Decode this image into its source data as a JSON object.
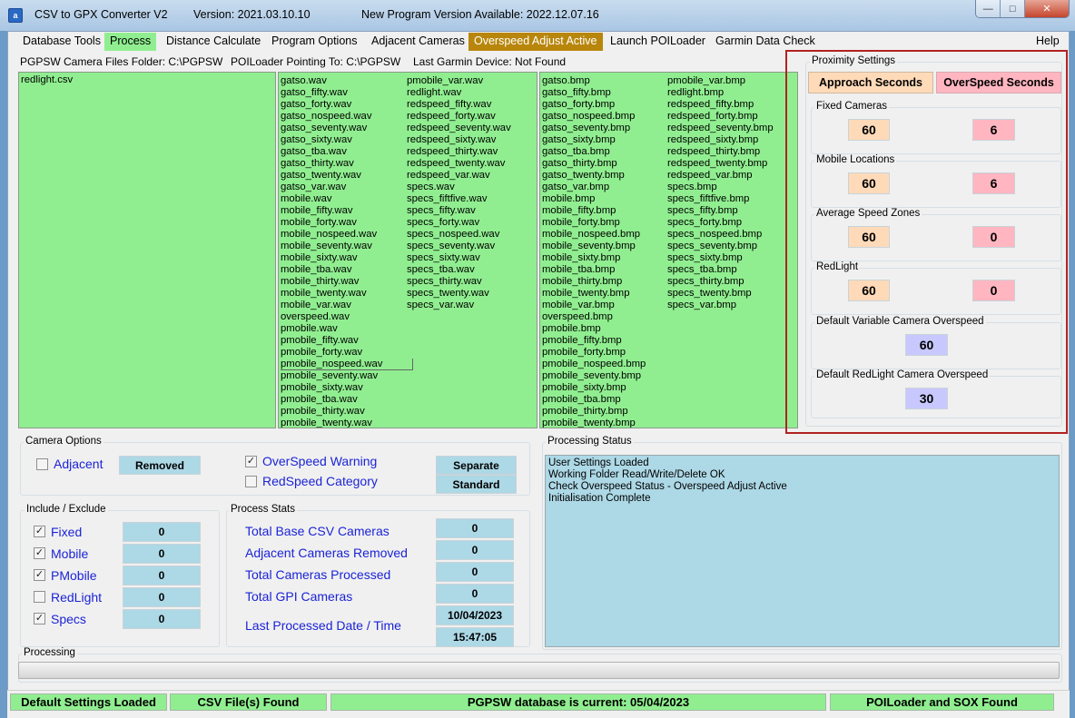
{
  "window": {
    "app_name": "CSV to GPX Converter V2",
    "version": "Version: 2021.03.10.10",
    "update_notice": "New Program Version Available: 2022.12.07.16",
    "icon_text": "a"
  },
  "menu": [
    "Database Tools",
    "Process",
    "Distance Calculate",
    "Program Options",
    "Adjacent Cameras",
    "Overspeed Adjust Active",
    "Launch POILoader",
    "Garmin Data Check",
    "Help"
  ],
  "info": {
    "folder": "PGPSW Camera Files Folder:  C:\\PGPSW",
    "poiloader": "POILoader Pointing To:  C:\\PGPSW",
    "last_device": "Last Garmin Device:  Not Found"
  },
  "csv_files": [
    "redlight.csv"
  ],
  "wav_files_col1": [
    "gatso.wav",
    "gatso_fifty.wav",
    "gatso_forty.wav",
    "gatso_nospeed.wav",
    "gatso_seventy.wav",
    "gatso_sixty.wav",
    "gatso_tba.wav",
    "gatso_thirty.wav",
    "gatso_twenty.wav",
    "gatso_var.wav",
    "mobile.wav",
    "mobile_fifty.wav",
    "mobile_forty.wav",
    "mobile_nospeed.wav",
    "mobile_seventy.wav",
    "mobile_sixty.wav",
    "mobile_tba.wav",
    "mobile_thirty.wav",
    "mobile_twenty.wav",
    "mobile_var.wav",
    "overspeed.wav",
    "pmobile.wav",
    "pmobile_fifty.wav",
    "pmobile_forty.wav",
    "pmobile_nospeed.wav",
    "pmobile_seventy.wav",
    "pmobile_sixty.wav",
    "pmobile_tba.wav",
    "pmobile_thirty.wav",
    "pmobile_twenty.wav"
  ],
  "wav_files_col2": [
    "pmobile_var.wav",
    "redlight.wav",
    "redspeed_fifty.wav",
    "redspeed_forty.wav",
    "redspeed_seventy.wav",
    "redspeed_sixty.wav",
    "redspeed_thirty.wav",
    "redspeed_twenty.wav",
    "redspeed_var.wav",
    "specs.wav",
    "specs_fiftfive.wav",
    "specs_fifty.wav",
    "specs_forty.wav",
    "specs_nospeed.wav",
    "specs_seventy.wav",
    "specs_sixty.wav",
    "specs_tba.wav",
    "specs_thirty.wav",
    "specs_twenty.wav",
    "specs_var.wav"
  ],
  "bmp_files_col1": [
    "gatso.bmp",
    "gatso_fifty.bmp",
    "gatso_forty.bmp",
    "gatso_nospeed.bmp",
    "gatso_seventy.bmp",
    "gatso_sixty.bmp",
    "gatso_tba.bmp",
    "gatso_thirty.bmp",
    "gatso_twenty.bmp",
    "gatso_var.bmp",
    "mobile.bmp",
    "mobile_fifty.bmp",
    "mobile_forty.bmp",
    "mobile_nospeed.bmp",
    "mobile_seventy.bmp",
    "mobile_sixty.bmp",
    "mobile_tba.bmp",
    "mobile_thirty.bmp",
    "mobile_twenty.bmp",
    "mobile_var.bmp",
    "overspeed.bmp",
    "pmobile.bmp",
    "pmobile_fifty.bmp",
    "pmobile_forty.bmp",
    "pmobile_nospeed.bmp",
    "pmobile_seventy.bmp",
    "pmobile_sixty.bmp",
    "pmobile_tba.bmp",
    "pmobile_thirty.bmp",
    "pmobile_twenty.bmp"
  ],
  "bmp_files_col2": [
    "pmobile_var.bmp",
    "redlight.bmp",
    "redspeed_fifty.bmp",
    "redspeed_forty.bmp",
    "redspeed_seventy.bmp",
    "redspeed_sixty.bmp",
    "redspeed_thirty.bmp",
    "redspeed_twenty.bmp",
    "redspeed_var.bmp",
    "specs.bmp",
    "specs_fiftfive.bmp",
    "specs_fifty.bmp",
    "specs_forty.bmp",
    "specs_nospeed.bmp",
    "specs_seventy.bmp",
    "specs_sixty.bmp",
    "specs_tba.bmp",
    "specs_thirty.bmp",
    "specs_twenty.bmp",
    "specs_var.bmp"
  ],
  "proximity": {
    "title": "Proximity Settings",
    "approach_header": "Approach Seconds",
    "overspeed_header": "OverSpeed Seconds",
    "fixed": {
      "label": "Fixed Cameras",
      "approach": "60",
      "overspeed": "6"
    },
    "mobile": {
      "label": "Mobile Locations",
      "approach": "60",
      "overspeed": "6"
    },
    "average": {
      "label": "Average Speed Zones",
      "approach": "60",
      "overspeed": "0"
    },
    "redlight": {
      "label": "RedLight",
      "approach": "60",
      "overspeed": "0"
    },
    "default_variable": {
      "label": "Default Variable Camera Overspeed",
      "value": "60"
    },
    "default_redlight": {
      "label": "Default RedLight Camera Overspeed",
      "value": "30"
    }
  },
  "camera_options": {
    "title": "Camera Options",
    "adjacent_label": "Adjacent",
    "adjacent_checked": false,
    "removed_label": "Removed",
    "overspeed_warning_label": "OverSpeed Warning",
    "overspeed_warning_checked": true,
    "redspeed_category_label": "RedSpeed Category",
    "redspeed_category_checked": false,
    "separate_label": "Separate",
    "standard_label": "Standard"
  },
  "include_exclude": {
    "title": "Include / Exclude",
    "items": [
      {
        "label": "Fixed",
        "checked": true,
        "value": "0"
      },
      {
        "label": "Mobile",
        "checked": true,
        "value": "0"
      },
      {
        "label": "PMobile",
        "checked": true,
        "value": "0"
      },
      {
        "label": "RedLight",
        "checked": false,
        "value": "0"
      },
      {
        "label": "Specs",
        "checked": true,
        "value": "0"
      }
    ]
  },
  "process_stats": {
    "title": "Process Stats",
    "total_base": {
      "label": "Total Base CSV Cameras",
      "value": "0"
    },
    "adjacent_removed": {
      "label": "Adjacent Cameras Removed",
      "value": "0"
    },
    "total_processed": {
      "label": "Total Cameras Processed",
      "value": "0"
    },
    "total_gpi": {
      "label": "Total GPI Cameras",
      "value": "0"
    },
    "last_processed": {
      "label": "Last Processed Date / Time",
      "date": "10/04/2023",
      "time": "15:47:05"
    }
  },
  "processing_status": {
    "title": "Processing Status",
    "lines": [
      "User Settings Loaded",
      "Working Folder Read/Write/Delete OK",
      "Check Overspeed Status - Overspeed Adjust Active",
      "Initialisation Complete"
    ]
  },
  "processing": {
    "title": "Processing",
    "progress": 0
  },
  "statusbar": {
    "defaults": "Default Settings Loaded",
    "csv": "CSV File(s) Found",
    "database": "PGPSW database is current: 05/04/2023",
    "poiloader": "POILoader and SOX Found"
  },
  "colors": {
    "green": "#90ee90",
    "gold": "#b8860b",
    "highlight_border": "#b22222"
  }
}
